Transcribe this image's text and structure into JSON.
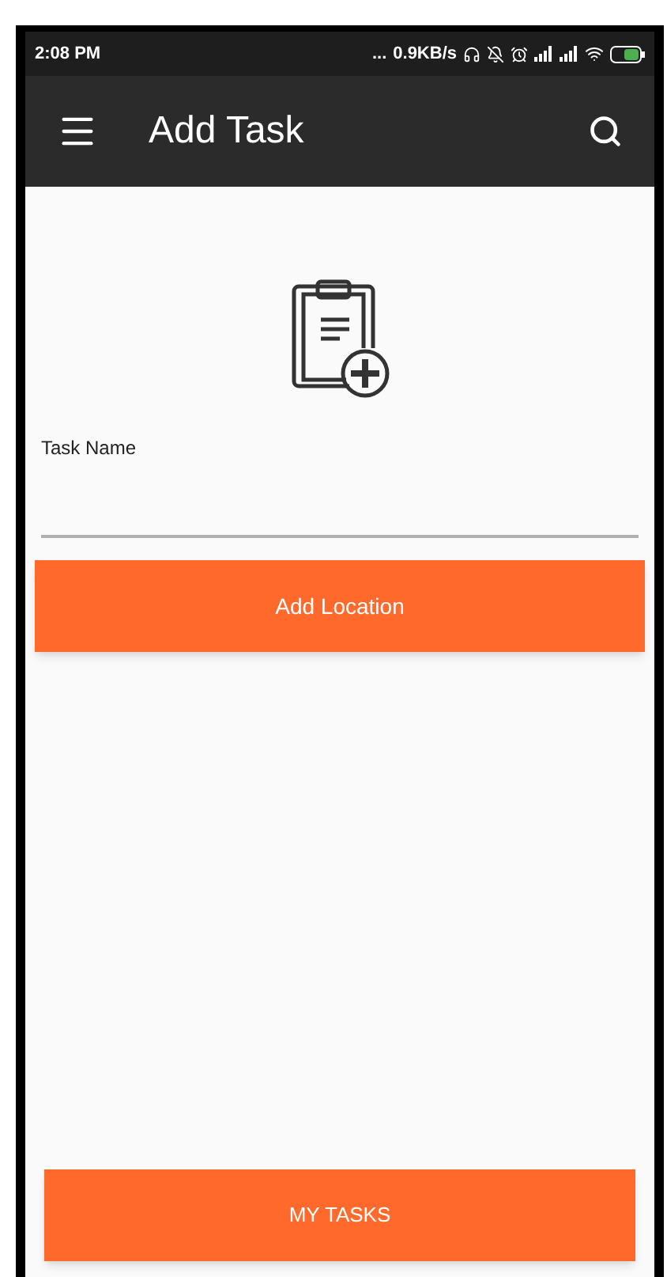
{
  "status_bar": {
    "time": "2:08 PM",
    "dots": "...",
    "speed": "0.9KB/s"
  },
  "app_bar": {
    "title": "Add Task"
  },
  "form": {
    "task_name_label": "Task Name",
    "add_location_button": "Add Location"
  },
  "bottom_button": "MY TASKS"
}
